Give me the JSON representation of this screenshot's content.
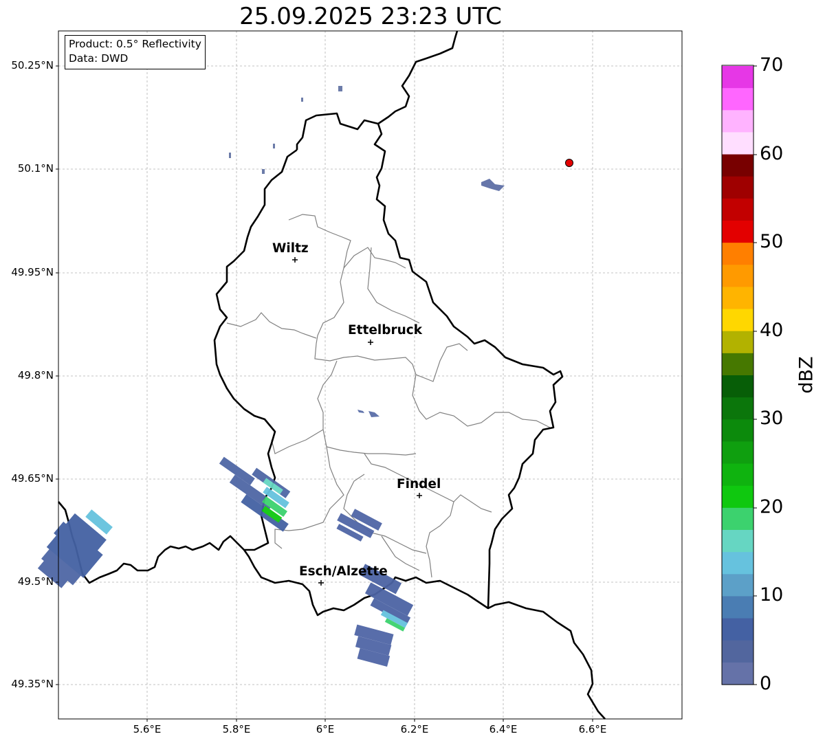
{
  "title": "25.09.2025 23:23 UTC",
  "info": {
    "product": "Product: 0.5° Reflectivity",
    "data": "Data: DWD"
  },
  "cities": [
    {
      "name": "Wiltz"
    },
    {
      "name": "Ettelbruck"
    },
    {
      "name": "Findel"
    },
    {
      "name": "Esch/Alzette"
    }
  ],
  "axes": {
    "lon_ticks": [
      "5.6°E",
      "5.8°E",
      "6°E",
      "6.2°E",
      "6.4°E",
      "6.6°E"
    ],
    "lat_ticks": [
      "50.25°N",
      "50.1°N",
      "49.95°N",
      "49.8°N",
      "49.65°N",
      "49.5°N",
      "49.35°N"
    ]
  },
  "colorbar": {
    "label": "dBZ",
    "ticks": [
      "70",
      "60",
      "50",
      "40",
      "30",
      "20",
      "10",
      "0"
    ],
    "colors": [
      "#e637e6",
      "#ff66ff",
      "#ffb3ff",
      "#ffdeff",
      "#780000",
      "#9f0000",
      "#c20000",
      "#e30000",
      "#ff7f00",
      "#ff9a00",
      "#ffb400",
      "#ffd700",
      "#b2b200",
      "#467800",
      "#075e07",
      "#0b760b",
      "#0c8a0c",
      "#0f9f0f",
      "#0fb30f",
      "#0fc80f",
      "#3cd26e",
      "#66d6c2",
      "#66c2de",
      "#5ca0c8",
      "#4a7db3",
      "#4461a3",
      "#52669e",
      "#6572a8"
    ]
  },
  "marker": {
    "color": "#e30000"
  }
}
